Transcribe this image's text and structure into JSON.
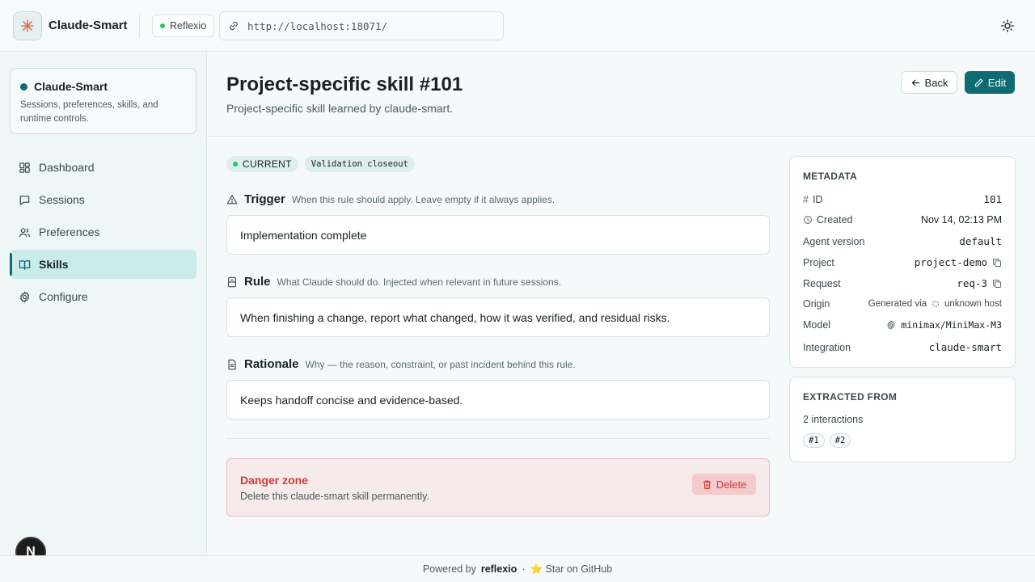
{
  "header": {
    "app_title": "Claude-Smart",
    "status_label": "Reflexio",
    "url": "http://localhost:18071/"
  },
  "sidebar": {
    "project": {
      "name": "Claude-Smart",
      "description": "Sessions, preferences, skills, and runtime controls."
    },
    "items": [
      {
        "label": "Dashboard",
        "icon": "dashboard-icon"
      },
      {
        "label": "Sessions",
        "icon": "chat-icon"
      },
      {
        "label": "Preferences",
        "icon": "users-icon"
      },
      {
        "label": "Skills",
        "icon": "book-icon",
        "active": true
      },
      {
        "label": "Configure",
        "icon": "gear-icon"
      }
    ],
    "badge_letter": "N"
  },
  "page": {
    "title": "Project-specific skill #101",
    "subtitle": "Project-specific skill learned by claude-smart.",
    "back_label": "Back",
    "edit_label": "Edit"
  },
  "skill": {
    "status": "CURRENT",
    "tag": "Validation closeout",
    "trigger": {
      "label": "Trigger",
      "hint": "When this rule should apply. Leave empty if it always applies.",
      "value": "Implementation complete"
    },
    "rule": {
      "label": "Rule",
      "hint": "What Claude should do. Injected when relevant in future sessions.",
      "value": "When finishing a change, report what changed, how it was verified, and residual risks."
    },
    "rationale": {
      "label": "Rationale",
      "hint": "Why — the reason, constraint, or past incident behind this rule.",
      "value": "Keeps handoff concise and evidence-based."
    }
  },
  "danger": {
    "title": "Danger zone",
    "description": "Delete this claude-smart skill permanently.",
    "delete_label": "Delete"
  },
  "metadata": {
    "title": "METADATA",
    "rows": [
      {
        "key": "ID",
        "value": "101"
      },
      {
        "key": "Created",
        "value": "Nov 14, 02:13 PM"
      },
      {
        "key": "Agent version",
        "value": "default"
      },
      {
        "key": "Project",
        "value": "project-demo"
      },
      {
        "key": "Request",
        "value": "req-3"
      },
      {
        "key": "Origin",
        "value": "Generated via",
        "value2": "unknown host"
      },
      {
        "key": "Model",
        "value": "minimax/MiniMax-M3"
      },
      {
        "key": "Integration",
        "value": "claude-smart"
      }
    ]
  },
  "extracted": {
    "title": "EXTRACTED FROM",
    "count_label": "2 interactions",
    "chips": [
      "#1",
      "#2"
    ]
  },
  "footer": {
    "powered_by": "Powered by",
    "brand": "reflexio",
    "separator": "·",
    "star": "⭐ Star on GitHub"
  },
  "colors": {
    "accent": "#0e6b74",
    "danger": "#d23a3a",
    "status_green": "#22c55e"
  }
}
